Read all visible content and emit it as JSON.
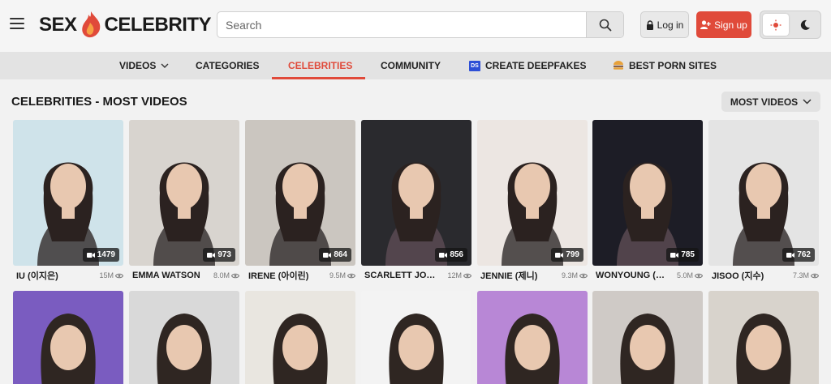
{
  "header": {
    "logo_left": "SEX",
    "logo_right": "CELEBRITY",
    "search_placeholder": "Search",
    "login_label": "Log in",
    "signup_label": "Sign up"
  },
  "nav": {
    "items": [
      {
        "label": "VIDEOS"
      },
      {
        "label": "CATEGORIES"
      },
      {
        "label": "CELEBRITIES"
      },
      {
        "label": "COMMUNITY"
      },
      {
        "label": "CREATE DEEPFAKES",
        "badge": "DS"
      },
      {
        "label": "BEST PORN SITES"
      }
    ]
  },
  "section": {
    "title": "CELEBRITIES - MOST VIDEOS",
    "sort_label": "MOST VIDEOS"
  },
  "celebrities": [
    {
      "name": "IU (이지은)",
      "videos": "1479",
      "views": "15M",
      "bg": "#cfe3ea"
    },
    {
      "name": "EMMA WATSON",
      "videos": "973",
      "views": "8.0M",
      "bg": "#d8d4cf"
    },
    {
      "name": "IRENE (아이린)",
      "videos": "864",
      "views": "9.5M",
      "bg": "#cbc6c0"
    },
    {
      "name": "SCARLETT JO…",
      "videos": "856",
      "views": "12M",
      "bg": "#2a2a2e"
    },
    {
      "name": "JENNIE (제니)",
      "videos": "799",
      "views": "9.3M",
      "bg": "#ece6e2"
    },
    {
      "name": "WONYOUNG (…",
      "videos": "785",
      "views": "5.0M",
      "bg": "#1d1d26"
    },
    {
      "name": "JISOO (지수)",
      "videos": "762",
      "views": "7.3M",
      "bg": "#e4e4e4"
    }
  ],
  "row2_bgs": [
    "#7a5cc0",
    "#d9d9d9",
    "#e9e6e0",
    "#f3f3f3",
    "#b887d6",
    "#cfcac6",
    "#d8d3cc"
  ]
}
